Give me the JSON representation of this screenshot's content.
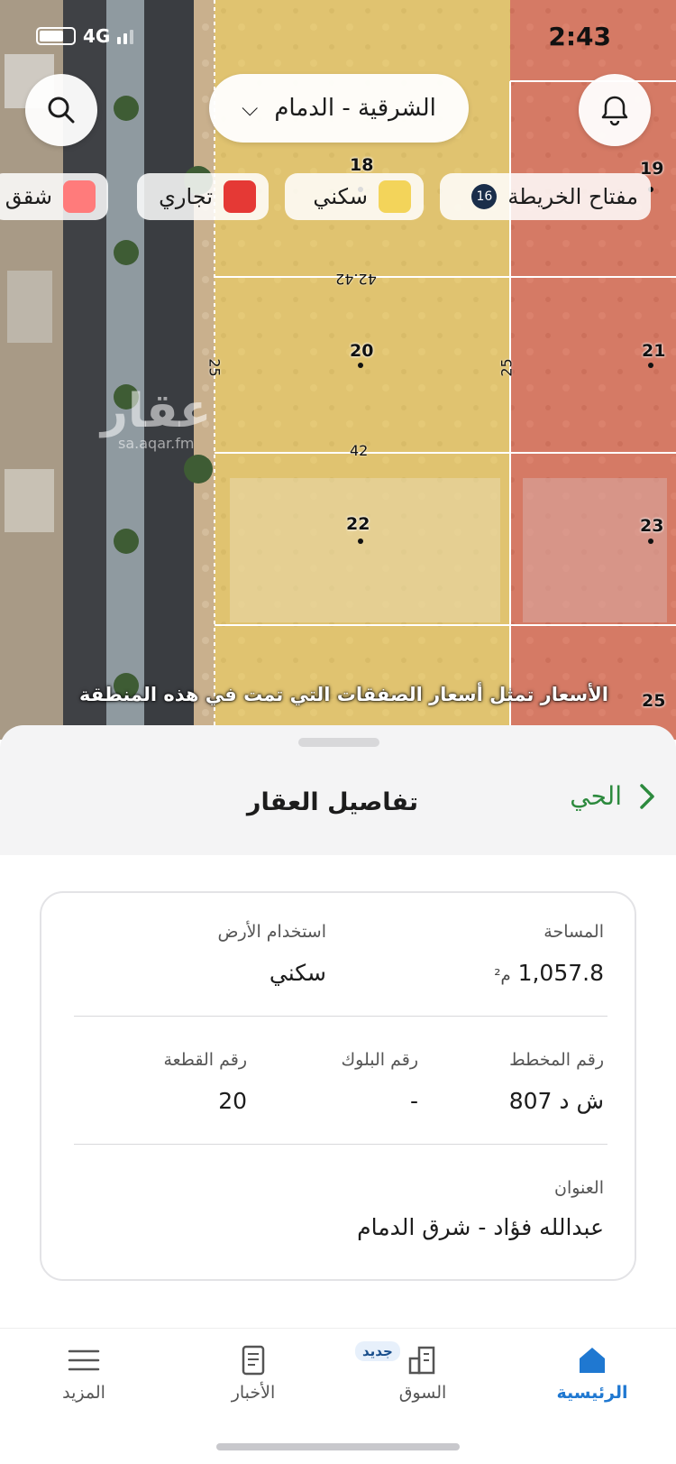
{
  "status": {
    "time": "2:43",
    "network": "4G"
  },
  "map": {
    "region": "الشرقية - الدمام",
    "legend": {
      "title": "مفتاح الخريطة",
      "count": "16",
      "residential": "سكني",
      "commercial": "تجاري",
      "apartments": "شقق"
    },
    "colors": {
      "residential": "#f3d45a",
      "commercial": "#e53935",
      "apartments": "#ff7b7b"
    },
    "plots": {
      "p18": "18",
      "p19": "19",
      "p20": "20",
      "p21": "21",
      "p22": "22",
      "p23": "23",
      "p25": "25"
    },
    "dims": {
      "d1": "42.42",
      "d2": "42",
      "d3": "25",
      "d4": "25"
    },
    "watermark": {
      "logo": "عقار",
      "site": "sa.aqar.fm"
    },
    "note": "الأسعار تمثل أسعار الصفقات التي تمت في هذه المنطقة"
  },
  "sheet": {
    "title": "تفاصيل العقار",
    "neighborhood_link": "الحي",
    "area_label": "المساحة",
    "area_value": "1,057.8",
    "area_unit": "م²",
    "land_use_label": "استخدام الأرض",
    "land_use_value": "سكني",
    "plan_label": "رقم المخطط",
    "plan_value": "ش د 807",
    "block_label": "رقم البلوك",
    "block_value": "-",
    "plot_label": "رقم القطعة",
    "plot_value": "20",
    "address_label": "العنوان",
    "address_value": "عبدالله فؤاد - شرق الدمام"
  },
  "tabs": {
    "home": "الرئيسية",
    "market": "السوق",
    "market_badge": "جديد",
    "news": "الأخبار",
    "more": "المزيد"
  },
  "accent": "#1f78d1"
}
